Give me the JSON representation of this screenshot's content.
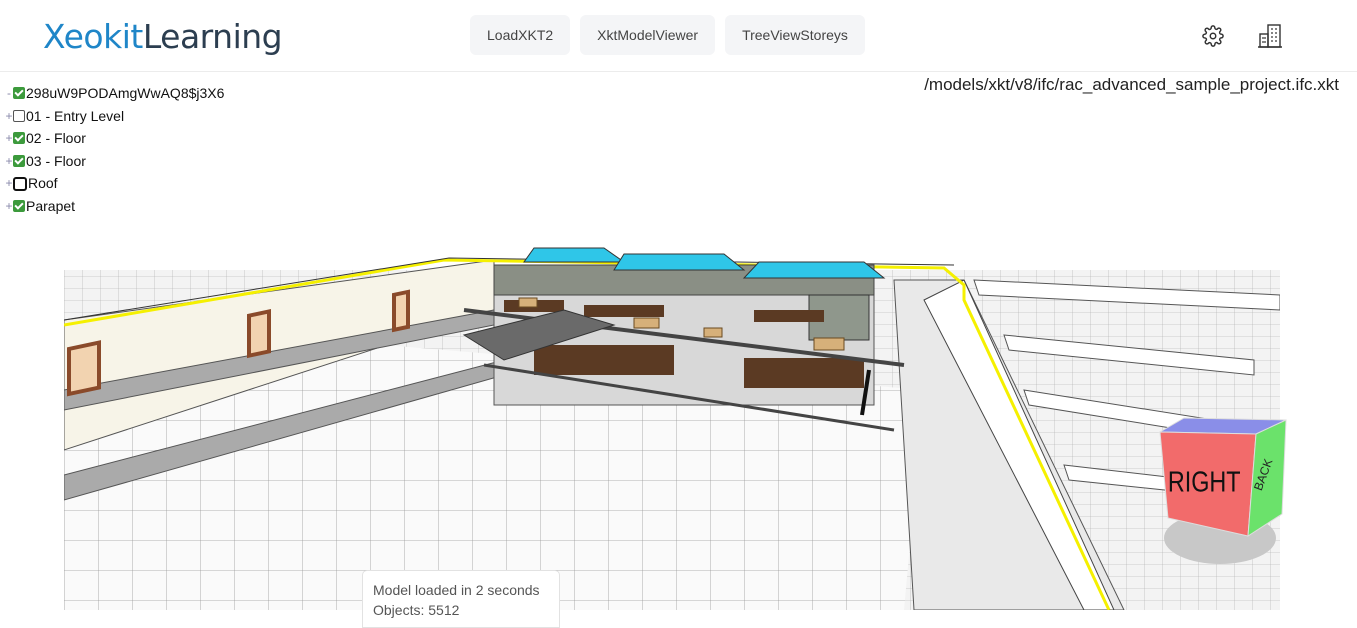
{
  "app": {
    "logo_part1": "Xeokit",
    "logo_part2": "Learning"
  },
  "nav": {
    "items": [
      {
        "label": "LoadXKT2"
      },
      {
        "label": "XktModelViewer"
      },
      {
        "label": "TreeViewStoreys"
      }
    ]
  },
  "toolbar": {
    "settings_icon": "gear-icon",
    "building_icon": "building-icon"
  },
  "tree": {
    "root": {
      "toggle": "-",
      "checked": true,
      "label": "298uW9PODAmgWwAQ8$j3X6"
    },
    "storeys": [
      {
        "toggle": "+",
        "checked": false,
        "label": "01 - Entry Level"
      },
      {
        "toggle": "+",
        "checked": true,
        "label": "02 - Floor"
      },
      {
        "toggle": "+",
        "checked": true,
        "label": "03 - Floor"
      },
      {
        "toggle": "+",
        "checked": false,
        "label": "Roof"
      },
      {
        "toggle": "+",
        "checked": true,
        "label": "Parapet"
      }
    ]
  },
  "model_path": "/models/xkt/v8/ifc/rac_advanced_sample_project.ifc.xkt",
  "navcube": {
    "face_right": "RIGHT",
    "face_back": "BACK",
    "colors": {
      "right": "#f26b6b",
      "back": "#6be26b",
      "top": "#8a8ee8"
    }
  },
  "status": {
    "load_message": "Model loaded in 2 seconds",
    "objects_text": "Objects: 5512"
  }
}
